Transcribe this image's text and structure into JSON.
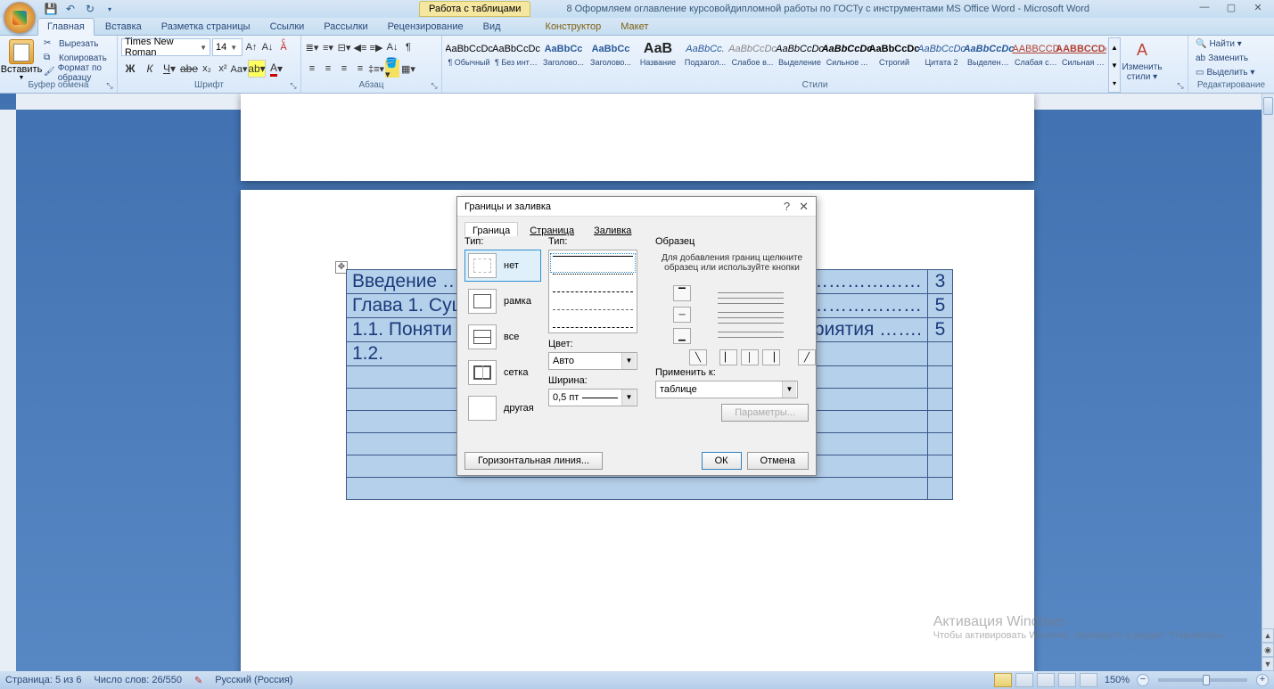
{
  "titlebar": {
    "contextual_tab": "Работа с таблицами",
    "doc_title": "8 Оформляем оглавление курсовойдипломной работы по ГОСТу с инструментами MS Office Word - Microsoft Word"
  },
  "tabs": {
    "items": [
      "Главная",
      "Вставка",
      "Разметка страницы",
      "Ссылки",
      "Рассылки",
      "Рецензирование",
      "Вид",
      "Конструктор",
      "Макет"
    ],
    "active": 0
  },
  "ribbon": {
    "clipboard": {
      "title": "Буфер обмена",
      "paste": "Вставить",
      "cut": "Вырезать",
      "copy": "Копировать",
      "format_painter": "Формат по образцу"
    },
    "font": {
      "title": "Шрифт",
      "name": "Times New Roman",
      "size": "14"
    },
    "paragraph": {
      "title": "Абзац"
    },
    "styles": {
      "title": "Стили",
      "items": [
        {
          "preview": "AaBbCcDc",
          "name": "¶ Обычный"
        },
        {
          "preview": "AaBbCcDc",
          "name": "¶ Без инте..."
        },
        {
          "preview": "AaBbCc",
          "name": "Заголово...",
          "color": "#2a5a9a",
          "bold": true
        },
        {
          "preview": "AaBbCc",
          "name": "Заголово...",
          "color": "#2a5a9a",
          "bold": true
        },
        {
          "preview": "АаВ",
          "name": "Название",
          "color": "#222",
          "size": "16px",
          "bold": true
        },
        {
          "preview": "AaBbCc.",
          "name": "Подзагол...",
          "color": "#2a5a9a",
          "italic": true
        },
        {
          "preview": "AaBbCcDc",
          "name": "Слабое в...",
          "color": "#888",
          "italic": true
        },
        {
          "preview": "AaBbCcDc",
          "name": "Выделение",
          "italic": true
        },
        {
          "preview": "AaBbCcDc",
          "name": "Сильное ...",
          "italic": true,
          "bold": true
        },
        {
          "preview": "AaBbCcDc",
          "name": "Строгий",
          "bold": true
        },
        {
          "preview": "AaBbCcDc",
          "name": "Цитата 2",
          "italic": true,
          "color": "#2a5a9a"
        },
        {
          "preview": "AaBbCcDc",
          "name": "Выделенн...",
          "italic": true,
          "bold": true,
          "color": "#2a5a9a"
        },
        {
          "preview": "AABBCCD",
          "name": "Слабая сс...",
          "color": "#b04030",
          "underline": true
        },
        {
          "preview": "AABBCCDc",
          "name": "Сильная с...",
          "color": "#b04030",
          "underline": true,
          "bold": true
        }
      ],
      "change": "Изменить стили ▾"
    },
    "editing": {
      "title": "Редактирование",
      "find": "Найти ▾",
      "replace": "Заменить",
      "select": "Выделить ▾"
    }
  },
  "document": {
    "toc": [
      {
        "text": "Введение ………………………………",
        "page": "3"
      },
      {
        "text": "Глава 1. Сущ",
        "tail": "…………………",
        "page": "5"
      },
      {
        "text": "1.1.    Поняти",
        "tail": "едприятия …….",
        "page": "5"
      },
      {
        "text": "1.2.",
        "page": ""
      }
    ]
  },
  "dialog": {
    "title": "Границы и заливка",
    "tabs": [
      "Граница",
      "Страница",
      "Заливка"
    ],
    "type_label": "Тип:",
    "types": [
      {
        "key": "none",
        "label": "нет"
      },
      {
        "key": "box",
        "label": "рамка"
      },
      {
        "key": "all",
        "label": "все"
      },
      {
        "key": "grid",
        "label": "сетка"
      },
      {
        "key": "custom",
        "label": "другая"
      }
    ],
    "style_label": "Тип:",
    "color_label": "Цвет:",
    "color_value": "Авто",
    "width_label": "Ширина:",
    "width_value": "0,5 пт",
    "preview_label": "Образец",
    "preview_hint": "Для добавления границ щелкните образец или используйте кнопки",
    "apply_label": "Применить к:",
    "apply_value": "таблице",
    "options": "Параметры...",
    "hline": "Горизонтальная линия...",
    "ok": "ОК",
    "cancel": "Отмена"
  },
  "statusbar": {
    "page": "Страница: 5 из 6",
    "words": "Число слов: 26/550",
    "lang": "Русский (Россия)",
    "zoom": "150%"
  },
  "watermark": {
    "title": "Активация Windows",
    "sub": "Чтобы активировать Windows, перейдите в раздел \"Параметры\"."
  }
}
